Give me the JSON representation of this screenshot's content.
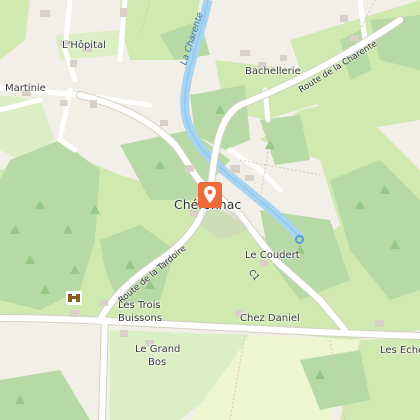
{
  "map": {
    "places": {
      "hopital": "L'Hôpital",
      "martinie": "Martinie",
      "bachellerie": "Bachellerie",
      "chenonnac": "Chéronnac",
      "le_coudert": "Le Coudert",
      "les_trois": "Les Trois",
      "buissons": "Buissons",
      "chez_daniel": "Chez Daniel",
      "le_grand": "Le Grand",
      "bos": "Bos",
      "les_eche": "Les Eche"
    },
    "roads": {
      "route_charente": "Route de la Charente",
      "route_tardoire": "Route de la Tardoire",
      "c1": "C1"
    },
    "river": "La Charente",
    "colors": {
      "background": "#f2efe9",
      "forest": "#b7d9a6",
      "meadow": "#cfe9b0",
      "water": "#a8d4f2",
      "road": "#ffffff",
      "marker": "#ef6a3a"
    },
    "icons": [
      "map-pin-icon",
      "binoculars-icon",
      "water-point-icon"
    ]
  }
}
